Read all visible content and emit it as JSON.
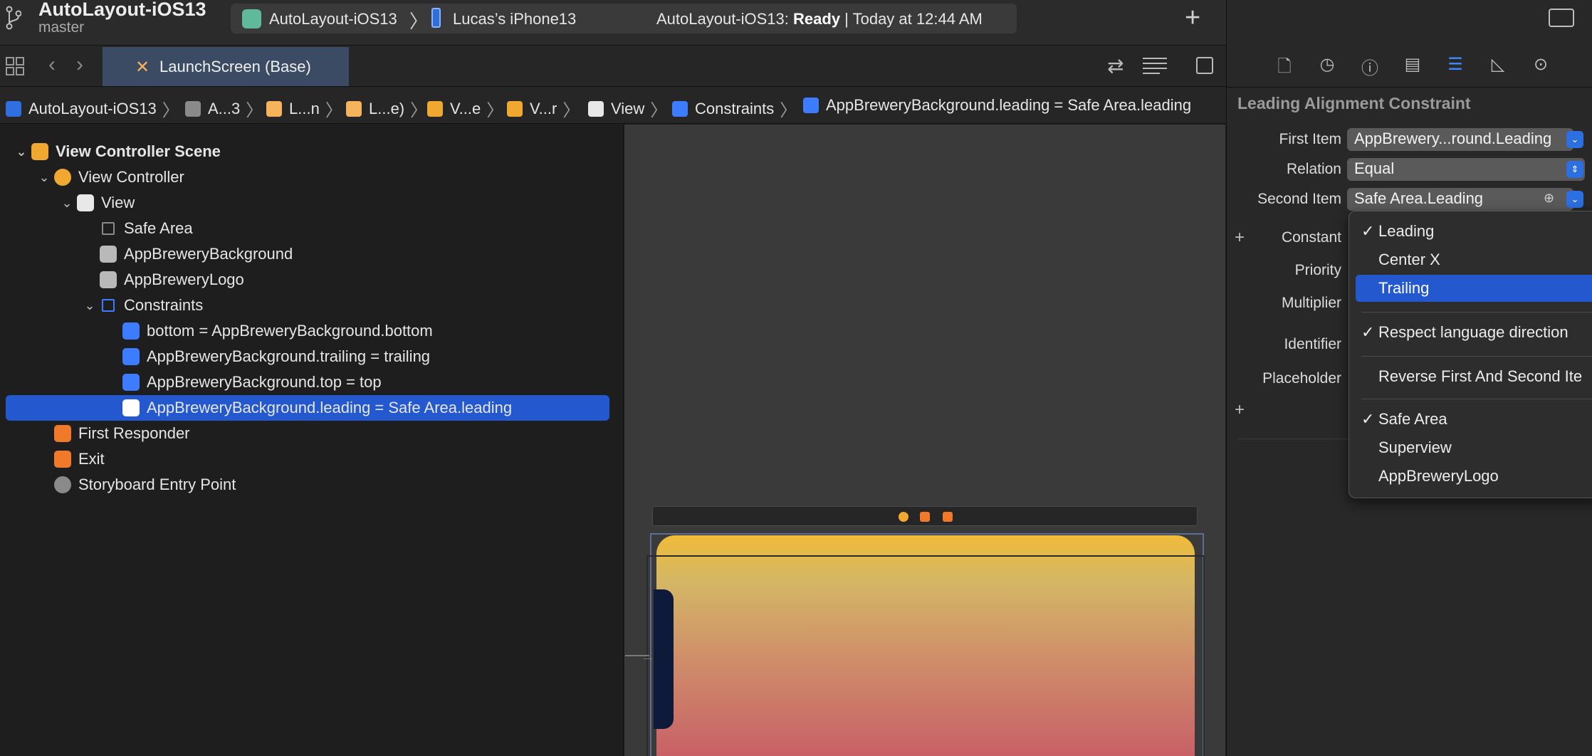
{
  "toolbar": {
    "project_title": "AutoLayout-iOS13",
    "branch": "master",
    "scheme": "AutoLayout-iOS13",
    "device": "Lucas’s iPhone13",
    "status_prefix": "AutoLayout-iOS13: ",
    "status_state": "Ready",
    "status_suffix": " | Today at 12:44 AM",
    "add_label": "+"
  },
  "tabs": {
    "active": "LaunchScreen (Base)"
  },
  "jumpbar": [
    {
      "label": "AutoLayout-iOS13",
      "icon": "project-icon",
      "color": "#2f6fe0"
    },
    {
      "label": "A...3",
      "icon": "folder-icon",
      "color": "#8a8a8a"
    },
    {
      "label": "L...n",
      "icon": "storyboard-icon",
      "color": "#f5b45c"
    },
    {
      "label": "L...e)",
      "icon": "storyboard-icon",
      "color": "#f5b45c"
    },
    {
      "label": "V...e",
      "icon": "scene-icon",
      "color": "#f0a830"
    },
    {
      "label": "V...r",
      "icon": "view-controller-icon",
      "color": "#f0a830"
    },
    {
      "label": "View",
      "icon": "view-icon",
      "color": "#e8e8e8"
    },
    {
      "label": "Constraints",
      "icon": "constraints-icon",
      "color": "#3d7bff"
    },
    {
      "label": "AppBreweryBackground.leading = Safe Area.leading",
      "icon": "constraint-icon",
      "color": "#3d7bff"
    }
  ],
  "outline": {
    "rows": [
      {
        "label": "View Controller Scene",
        "depth": 0,
        "chevron": "⌄",
        "icon": "scene-icon",
        "color": "#f0a830",
        "bold": true
      },
      {
        "label": "View Controller",
        "depth": 1,
        "chevron": "⌄",
        "icon": "view-controller-icon",
        "color": "#f0a830"
      },
      {
        "label": "View",
        "depth": 2,
        "chevron": "⌄",
        "icon": "view-icon",
        "color": "#e8e8e8"
      },
      {
        "label": "Safe Area",
        "depth": 3,
        "chevron": "",
        "icon": "safe-area-icon",
        "color": "#8a8a8a"
      },
      {
        "label": "AppBreweryBackground",
        "depth": 3,
        "chevron": "",
        "icon": "image-view-icon",
        "color": "#b9b9b9"
      },
      {
        "label": "AppBreweryLogo",
        "depth": 3,
        "chevron": "",
        "icon": "image-view-icon",
        "color": "#b9b9b9"
      },
      {
        "label": "Constraints",
        "depth": 3,
        "chevron": "⌄",
        "icon": "constraints-icon",
        "color": "#3d7bff"
      },
      {
        "label": "bottom = AppBreweryBackground.bottom",
        "depth": 4,
        "chevron": "",
        "icon": "constraint-bottom-icon",
        "color": "#3d7bff"
      },
      {
        "label": "AppBreweryBackground.trailing = trailing",
        "depth": 4,
        "chevron": "",
        "icon": "constraint-trailing-icon",
        "color": "#3d7bff"
      },
      {
        "label": "AppBreweryBackground.top = top",
        "depth": 4,
        "chevron": "",
        "icon": "constraint-top-icon",
        "color": "#3d7bff"
      },
      {
        "label": "AppBreweryBackground.leading = Safe Area.leading",
        "depth": 4,
        "chevron": "",
        "icon": "constraint-leading-icon",
        "color": "#ffffff",
        "selected": true
      },
      {
        "label": "First Responder",
        "depth": 1,
        "chevron": "",
        "icon": "first-responder-icon",
        "color": "#f07a2a"
      },
      {
        "label": "Exit",
        "depth": 1,
        "chevron": "",
        "icon": "exit-icon",
        "color": "#f07a2a"
      },
      {
        "label": "Storyboard Entry Point",
        "depth": 1,
        "chevron": "",
        "icon": "entry-point-icon",
        "color": "#8a8a8a"
      }
    ]
  },
  "inspector": {
    "title": "Leading Alignment Constraint",
    "first_item_label": "First Item",
    "first_item_value": "AppBrewery...round.Leading",
    "relation_label": "Relation",
    "relation_value": "Equal",
    "second_item_label": "Second Item",
    "second_item_value": "Safe Area.Leading",
    "constant_label": "Constant",
    "priority_label": "Priority",
    "multiplier_label": "Multiplier",
    "identifier_label": "Identifier",
    "placeholder_label": "Placeholder",
    "plus": "+"
  },
  "menu": {
    "items": [
      {
        "label": "Leading",
        "checked": true
      },
      {
        "label": "Center X",
        "checked": false
      },
      {
        "label": "Trailing",
        "checked": false,
        "highlighted": true
      },
      {
        "label": "Respect language direction",
        "checked": true
      },
      {
        "label": "Reverse First And Second Ite",
        "checked": false
      },
      {
        "label": "Safe Area",
        "checked": true
      },
      {
        "label": "Superview",
        "checked": false
      },
      {
        "label": "AppBreweryLogo",
        "checked": false
      }
    ],
    "checkmark": "✓"
  },
  "colors": {
    "accent": "#2458cf",
    "toolbar_bg": "#2b2b2b",
    "canvas_bg": "#3a3a3a"
  }
}
